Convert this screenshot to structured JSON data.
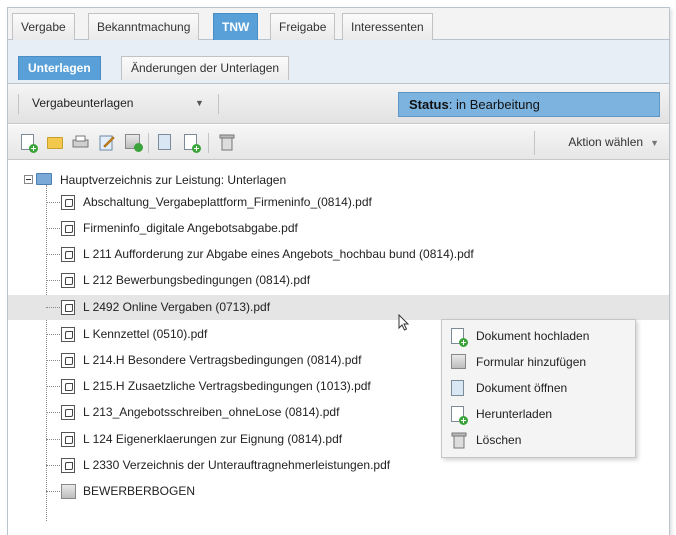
{
  "main_tabs": [
    {
      "label": "Vergabe",
      "active": false
    },
    {
      "label": "Bekanntmachung",
      "active": false
    },
    {
      "label": "TNW",
      "active": true
    },
    {
      "label": "Freigabe",
      "active": false
    },
    {
      "label": "Interessenten",
      "active": false
    }
  ],
  "sub_tabs": [
    {
      "label": "Unterlagen",
      "active": true
    },
    {
      "label": "Änderungen der Unterlagen",
      "active": false
    }
  ],
  "toolbar": {
    "selected_view": "Vergabeunterlagen",
    "status_label": "Status",
    "status_value": ": in Bearbeitung",
    "action_label": "Aktion wählen",
    "icons": [
      "new-document-icon",
      "folder-icon",
      "print-icon",
      "edit-icon",
      "add-form-icon",
      "open-document-icon",
      "download-icon",
      "delete-icon"
    ]
  },
  "tree": {
    "root_label": "Hauptverzeichnis zur Leistung: Unterlagen",
    "items": [
      "Abschaltung_Vergabeplattform_Firmeninfo_(0814).pdf",
      "Firmeninfo_digitale Angebotsabgabe.pdf",
      "L 211 Aufforderung zur Abgabe eines Angebots_hochbau bund (0814).pdf",
      "L 212 Bewerbungsbedingungen (0814).pdf",
      "L 2492 Online Vergaben (0713).pdf",
      "L Kennzettel (0510).pdf",
      "L 214.H Besondere Vertragsbedingungen (0814).pdf",
      "L 215.H Zusaetzliche Vertragsbedingungen (1013).pdf",
      "L 213_Angebotsschreiben_ohneLose (0814).pdf",
      "L 124 Eigenerklaerungen zur Eignung (0814).pdf",
      "L 2330 Verzeichnis der Unterauftragnehmerleistungen.pdf",
      "BEWERBERBOGEN"
    ],
    "hovered_index": 4
  },
  "context_menu": {
    "items": [
      {
        "label": "Dokument hochladen",
        "icon": "upload-document-icon"
      },
      {
        "label": "Formular hinzufügen",
        "icon": "add-form-icon"
      },
      {
        "label": "Dokument öffnen",
        "icon": "open-document-icon"
      },
      {
        "label": "Herunterladen",
        "icon": "download-icon"
      },
      {
        "label": "Löschen",
        "icon": "delete-icon"
      }
    ]
  },
  "colors": {
    "active_tab": "#5aa0d8",
    "status_bg": "#7db3df",
    "hover_row": "#e5e5e5"
  }
}
